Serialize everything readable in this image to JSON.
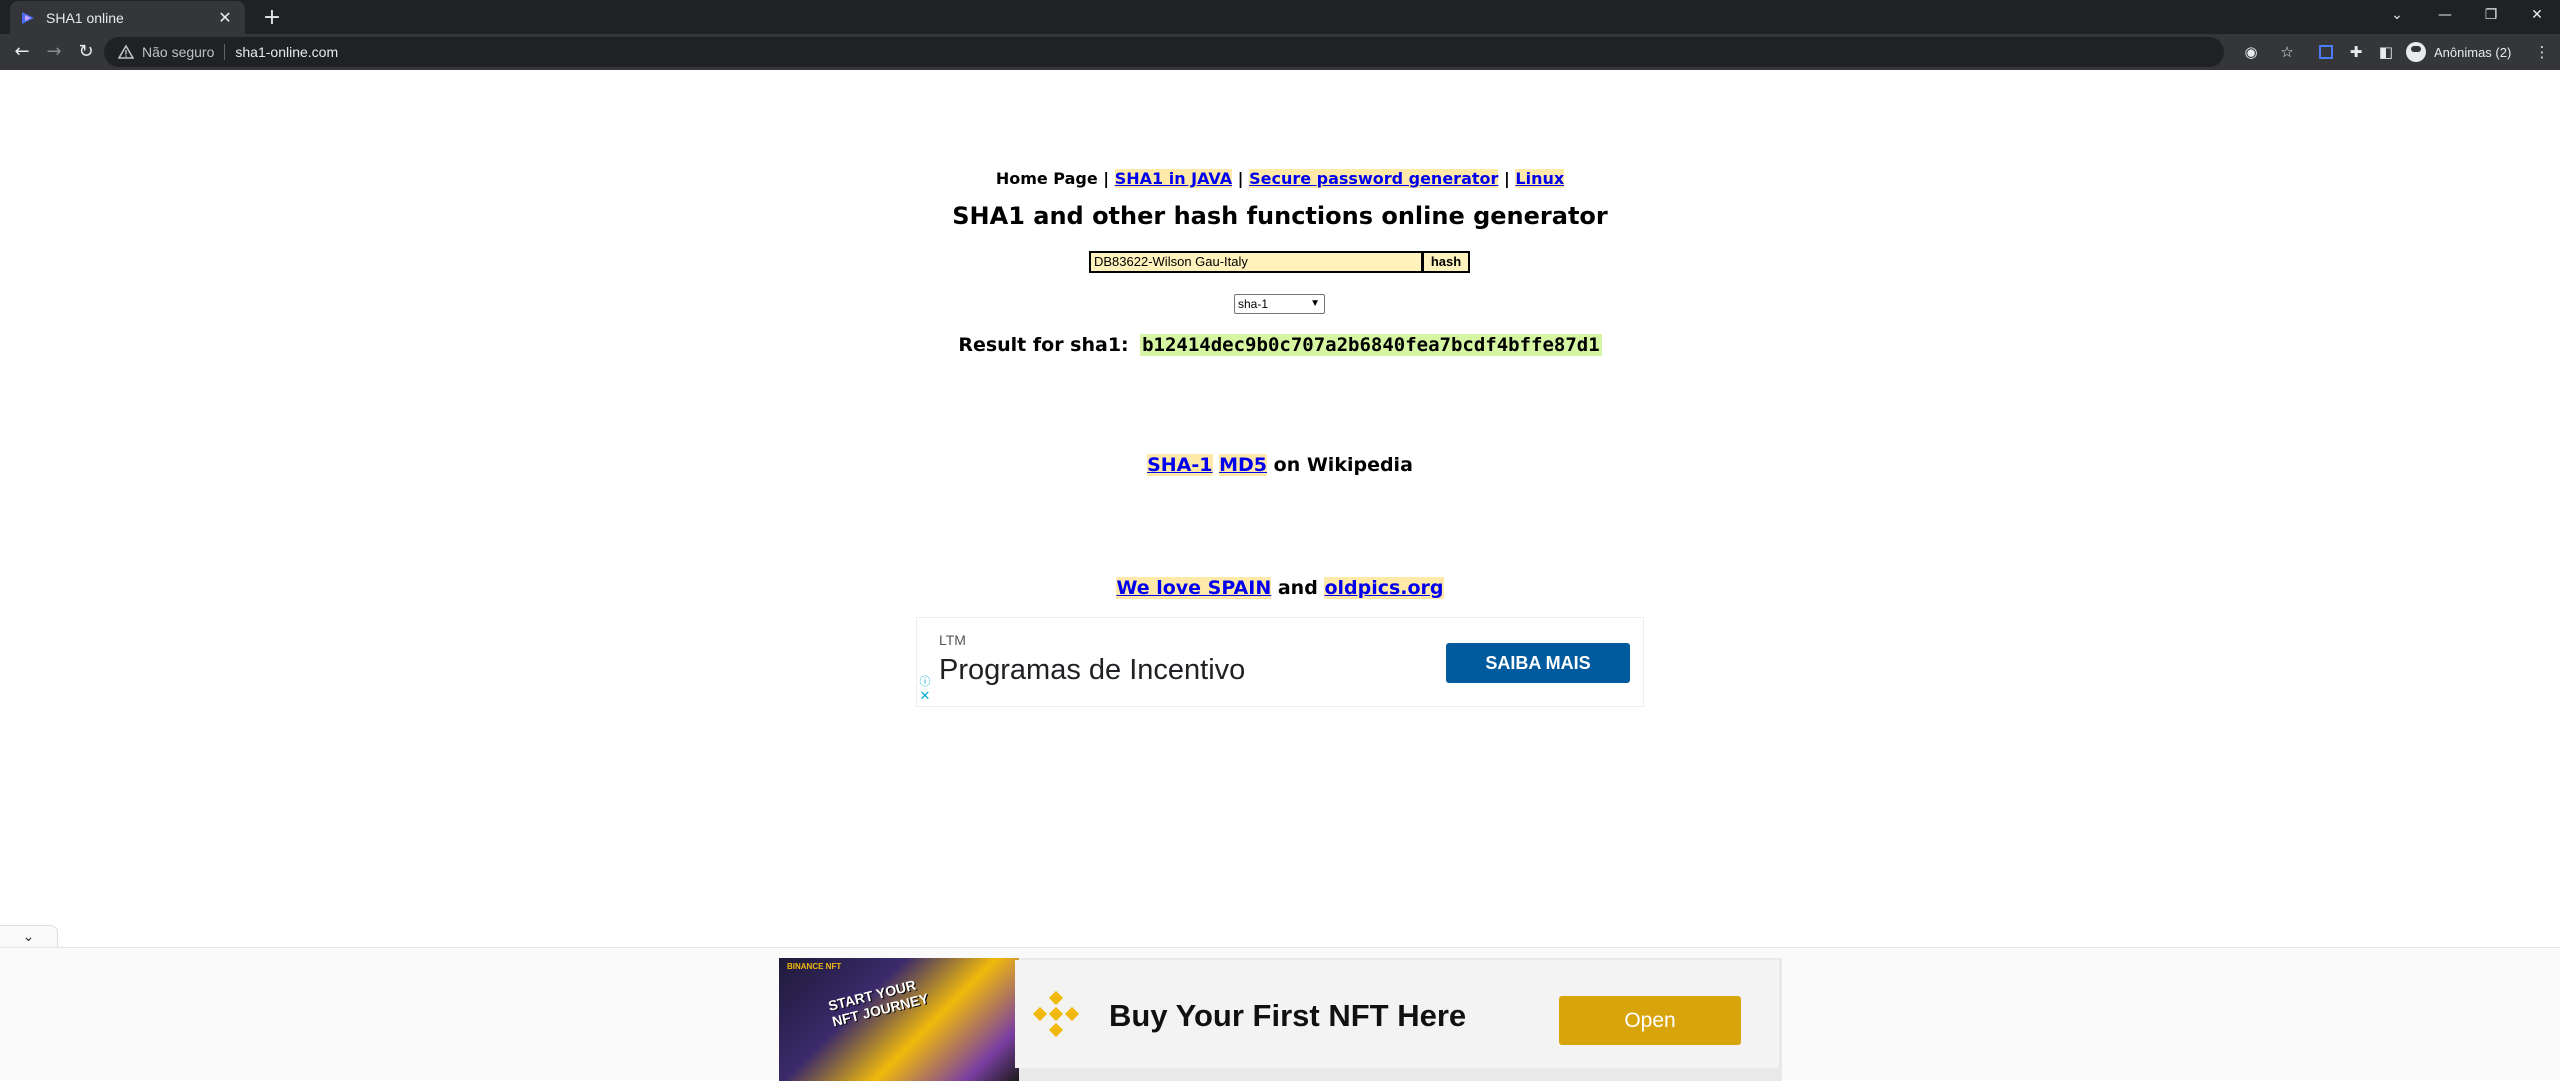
{
  "browser": {
    "tab": {
      "title": "SHA1 online"
    },
    "address": {
      "security": "Não seguro",
      "url": "sha1-online.com"
    },
    "profile": {
      "label": "Anônimas (2)"
    }
  },
  "page": {
    "nav": {
      "home": "Home Page",
      "sep": "|",
      "link_java": "SHA1 in JAVA",
      "link_password": "Secure password generator",
      "link_linux": "Linux"
    },
    "title": "SHA1 and other hash functions online generator",
    "form": {
      "input_value": "DB83622-Wilson Gau-Italy",
      "button_label": "hash",
      "algorithm": "sha-1"
    },
    "result": {
      "label": "Result for sha1:",
      "hash": "b12414dec9b0c707a2b6840fea7bcdf4bffe87d1"
    },
    "wiki": {
      "link_sha1": "SHA-1",
      "link_md5": "MD5",
      "suffix": "on Wikipedia"
    },
    "love": {
      "link_spain": "We love SPAIN",
      "and": "and",
      "link_oldpics": "oldpics.org"
    }
  },
  "ads": {
    "banner": {
      "brand": "LTM",
      "title": "Programas de Incentivo",
      "button": "SAIBA MAIS"
    },
    "anchor": {
      "art_brand": "BINANCE NFT",
      "art_text_1": "START YOUR",
      "art_text_2": "NFT JOURNEY",
      "title": "Buy Your First NFT Here",
      "button": "Open"
    }
  },
  "colors": {
    "chrome_dark": "#202124",
    "chrome_toolbar": "#35363a",
    "link_highlight": "#ffe9a8",
    "result_highlight": "#d6f5a3",
    "ad_button_blue": "#005b9e",
    "ad_button_gold": "#d8a40c"
  }
}
